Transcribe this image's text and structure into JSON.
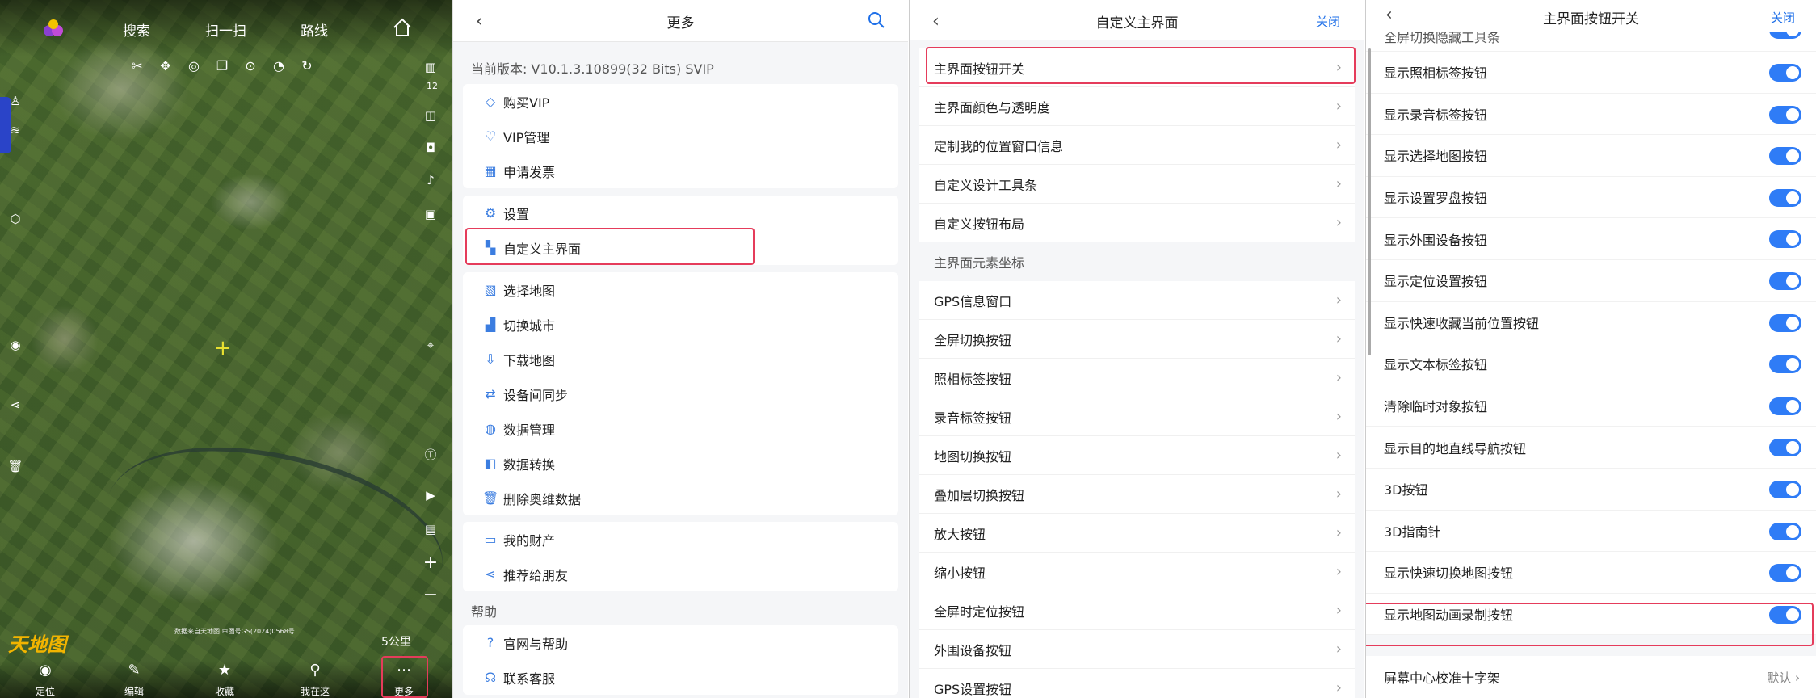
{
  "map": {
    "tabs": [
      "搜索",
      "扫一扫",
      "路线"
    ],
    "scale": "5公里",
    "watermark": "天地图",
    "copyright": "数据来自天地图 审图号GS(2024)0568号",
    "side_num": "12",
    "bottom": [
      "定位",
      "编辑",
      "收藏",
      "我在这",
      "更多"
    ]
  },
  "more": {
    "title": "更多",
    "version": "当前版本: V10.1.3.10899(32 Bits) SVIP",
    "s1": [
      "购买VIP",
      "VIP管理",
      "申请发票"
    ],
    "s2": [
      "设置",
      "自定义主界面"
    ],
    "s3": [
      "选择地图",
      "切换城市",
      "下载地图",
      "设备间同步",
      "数据管理",
      "数据转换",
      "删除奥维数据"
    ],
    "s4": [
      "我的财产",
      "推荐给朋友"
    ],
    "help": "帮助",
    "s5": [
      "官网与帮助",
      "联系客服"
    ]
  },
  "custom": {
    "title": "自定义主界面",
    "close": "关闭",
    "items": [
      "主界面按钮开关",
      "主界面颜色与透明度",
      "定制我的位置窗口信息",
      "自定义设计工具条",
      "自定义按钮布局"
    ],
    "section": "主界面元素坐标",
    "items2": [
      "GPS信息窗口",
      "全屏切换按钮",
      "照相标签按钮",
      "录音标签按钮",
      "地图切换按钮",
      "叠加层切换按钮",
      "放大按钮",
      "缩小按钮",
      "全屏时定位按钮",
      "外围设备按钮",
      "GPS设置按钮"
    ]
  },
  "switches": {
    "title": "主界面按钮开关",
    "close": "关闭",
    "partial": "全屏切换隐藏工具条",
    "items": [
      "显示照相标签按钮",
      "显示录音标签按钮",
      "显示选择地图按钮",
      "显示设置罗盘按钮",
      "显示外围设备按钮",
      "显示定位设置按钮",
      "显示快速收藏当前位置按钮",
      "显示文本标签按钮",
      "清除临时对象按钮",
      "显示目的地直线导航按钮",
      "3D按钮",
      "3D指南针",
      "显示快速切换地图按钮",
      "显示地图动画录制按钮"
    ],
    "toggles_on": [
      true,
      true,
      true,
      true,
      true,
      true,
      true,
      true,
      true,
      true,
      true,
      true,
      true,
      true,
      true
    ],
    "last": "屏幕中心校准十字架",
    "last_value": "默认"
  },
  "colors": {
    "accent": "#2f7cf6",
    "highlight": "#e53c5b"
  }
}
